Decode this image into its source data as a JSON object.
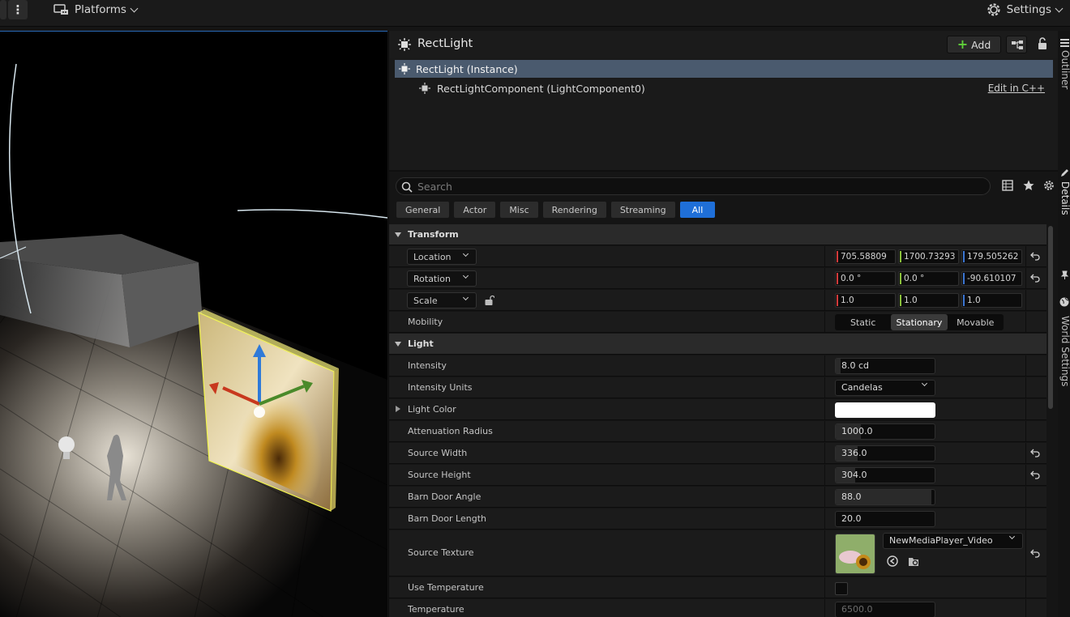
{
  "toolbar": {
    "platforms_label": "Platforms",
    "settings_label": "Settings"
  },
  "details": {
    "title": "RectLight",
    "add_label": "Add",
    "components": {
      "instance": "RectLight (Instance)",
      "component": "RectLightComponent (LightComponent0)",
      "edit_link": "Edit in C++"
    },
    "search_placeholder": "Search",
    "filter_tabs": [
      "General",
      "Actor",
      "Misc",
      "Rendering",
      "Streaming",
      "All"
    ],
    "active_filter": "All",
    "transform": {
      "category": "Transform",
      "location_label": "Location",
      "location": [
        "705.58809",
        "1700.73293",
        "179.505262"
      ],
      "rotation_label": "Rotation",
      "rotation": [
        "0.0 °",
        "0.0 °",
        "-90.610107"
      ],
      "scale_label": "Scale",
      "scale": [
        "1.0",
        "1.0",
        "1.0"
      ],
      "mobility_label": "Mobility",
      "mobility_options": [
        "Static",
        "Stationary",
        "Movable"
      ],
      "mobility_selected": "Stationary"
    },
    "light": {
      "category": "Light",
      "intensity_label": "Intensity",
      "intensity": "8.0 cd",
      "intensity_units_label": "Intensity Units",
      "intensity_units": "Candelas",
      "light_color_label": "Light Color",
      "light_color": "#ffffff",
      "attenuation_label": "Attenuation Radius",
      "attenuation": "1000.0",
      "source_width_label": "Source Width",
      "source_width": "336.0",
      "source_height_label": "Source Height",
      "source_height": "304.0",
      "barn_angle_label": "Barn Door Angle",
      "barn_angle": "88.0",
      "barn_length_label": "Barn Door Length",
      "barn_length": "20.0",
      "source_texture_label": "Source Texture",
      "source_texture": "NewMediaPlayer_Video",
      "use_temperature_label": "Use Temperature",
      "use_temperature": false,
      "temperature_label": "Temperature",
      "temperature": "6500.0"
    },
    "right_tabs": [
      "Outliner",
      "Details",
      "World Settings"
    ]
  },
  "colors": {
    "accent": "#1f6fd8",
    "selected_row": "#4a5a6e",
    "axis_x": "#d23b3b",
    "axis_y": "#8ac13b",
    "axis_z": "#3b76d2"
  }
}
